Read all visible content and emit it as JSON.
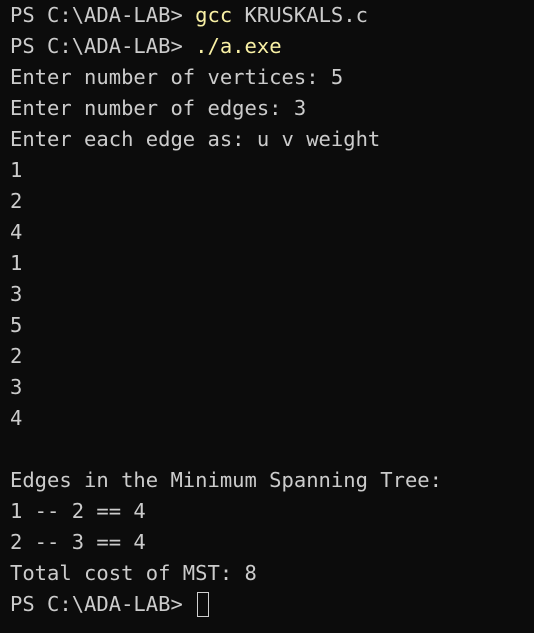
{
  "terminal": {
    "prompt": "PS C:\\ADA-LAB> ",
    "commands": [
      {
        "cmd": "gcc",
        "args": " KRUSKALS.c"
      },
      {
        "cmd": "./a.exe",
        "args": ""
      }
    ],
    "output": [
      "Enter number of vertices: 5",
      "Enter number of edges: 3",
      "Enter each edge as: u v weight",
      "1",
      "2",
      "4",
      "1",
      "3",
      "5",
      "2",
      "3",
      "4",
      "",
      "Edges in the Minimum Spanning Tree:",
      "1 -- 2 == 4",
      "2 -- 3 == 4",
      "Total cost of MST: 8"
    ],
    "final_prompt": "PS C:\\ADA-LAB> "
  }
}
